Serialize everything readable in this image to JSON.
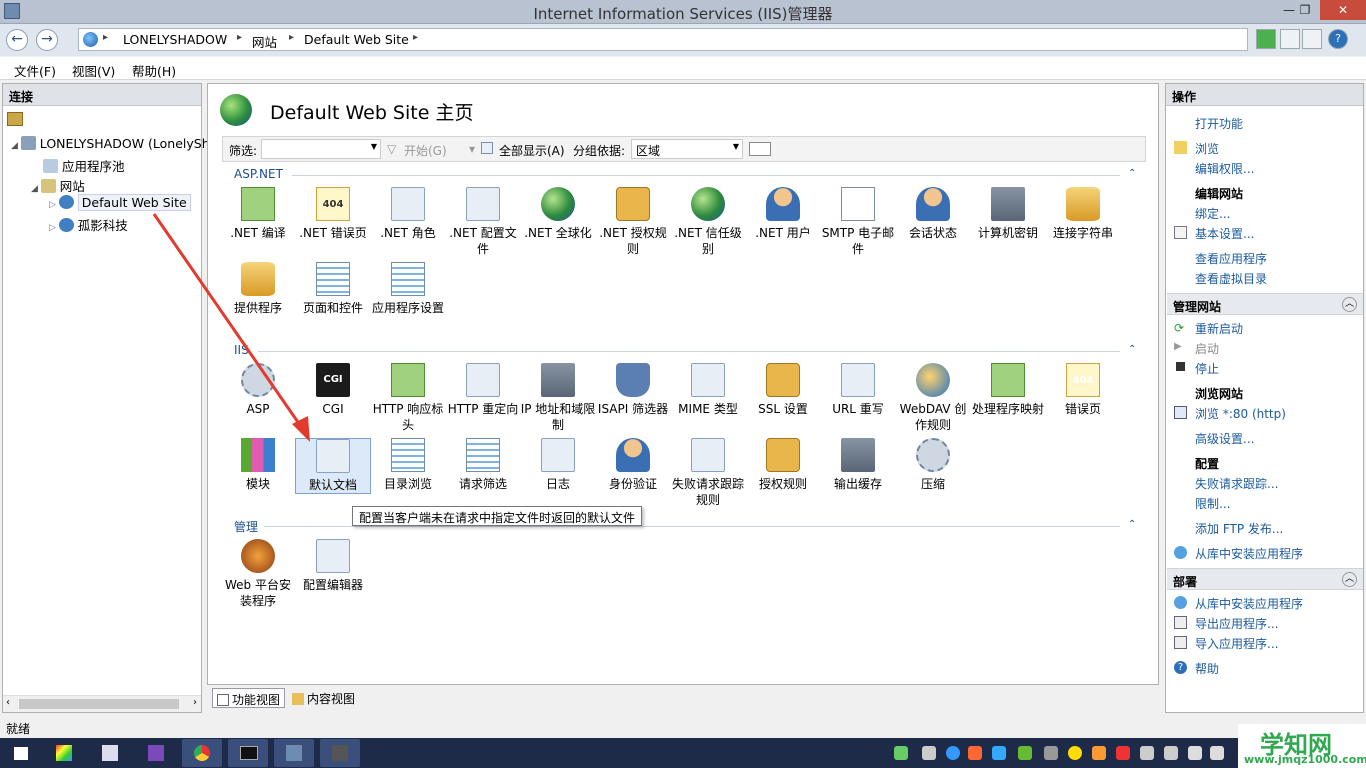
{
  "window": {
    "title": "Internet Information Services (IIS)管理器",
    "min": "—",
    "max": "❐",
    "close": "✕"
  },
  "address": {
    "crumbs": [
      "LONELYSHADOW",
      "网站",
      "Default Web Site"
    ],
    "sep": "▸"
  },
  "menu": [
    "文件(F)",
    "视图(V)",
    "帮助(H)"
  ],
  "left": {
    "header": "连接",
    "tree": {
      "server": "LONELYSHADOW (LonelySh",
      "apppools": "应用程序池",
      "sites": "网站",
      "site1": "Default Web Site",
      "site2": "孤影科技"
    }
  },
  "center": {
    "title": "Default Web Site 主页",
    "filter_label": "筛选:",
    "start": "开始(G)",
    "showall": "全部显示(A)",
    "groupby_label": "分组依据:",
    "groupby_value": "区域",
    "sections": {
      "aspnet": "ASP.NET",
      "iis": "IIS",
      "mgmt": "管理"
    },
    "aspnet_row1": [
      ".NET 编译",
      ".NET 错误页",
      ".NET 角色",
      ".NET 配置文件",
      ".NET 全球化",
      ".NET 授权规则",
      ".NET 信任级别",
      ".NET 用户",
      "SMTP 电子邮件",
      "会话状态",
      "计算机密钥",
      "连接字符串"
    ],
    "aspnet_row2": [
      "提供程序",
      "页面和控件",
      "应用程序设置"
    ],
    "iis_row1": [
      "ASP",
      "CGI",
      "HTTP 响应标头",
      "HTTP 重定向",
      "IP 地址和域限制",
      "ISAPI 筛选器",
      "MIME 类型",
      "SSL 设置",
      "URL 重写",
      "WebDAV 创作规则",
      "处理程序映射",
      "错误页"
    ],
    "iis_row2": [
      "模块",
      "默认文档",
      "目录浏览",
      "请求筛选",
      "日志",
      "身份验证",
      "失败请求跟踪规则",
      "授权规则",
      "输出缓存",
      "压缩"
    ],
    "mgmt_row": [
      "Web 平台安装程序",
      "配置编辑器"
    ],
    "tooltip": "配置当客户端未在请求中指定文件时返回的默认文件",
    "cgi_text": "CGI",
    "err_text": "404"
  },
  "viewtabs": {
    "features": "功能视图",
    "content": "内容视图"
  },
  "right": {
    "header": "操作",
    "open_feature": "打开功能",
    "browse": "浏览",
    "edit_perm": "编辑权限...",
    "edit_site": "编辑网站",
    "bind": "绑定...",
    "basic": "基本设置...",
    "view_apps": "查看应用程序",
    "view_vdirs": "查看虚拟目录",
    "manage_site": "管理网站",
    "restart": "重新启动",
    "start": "启动",
    "stop": "停止",
    "browse_site": "浏览网站",
    "browse80": "浏览 *:80 (http)",
    "advanced": "高级设置...",
    "config": "配置",
    "failed_trace": "失败请求跟踪...",
    "limits": "限制...",
    "ftp": "添加 FTP 发布...",
    "install_gallery": "从库中安装应用程序",
    "deploy": "部署",
    "install_gallery2": "从库中安装应用程序",
    "export": "导出应用程序...",
    "import": "导入应用程序...",
    "help": "帮助"
  },
  "status": "就绪",
  "watermark": {
    "line1": "学知网",
    "line2": "www.jmqz1000.com"
  }
}
